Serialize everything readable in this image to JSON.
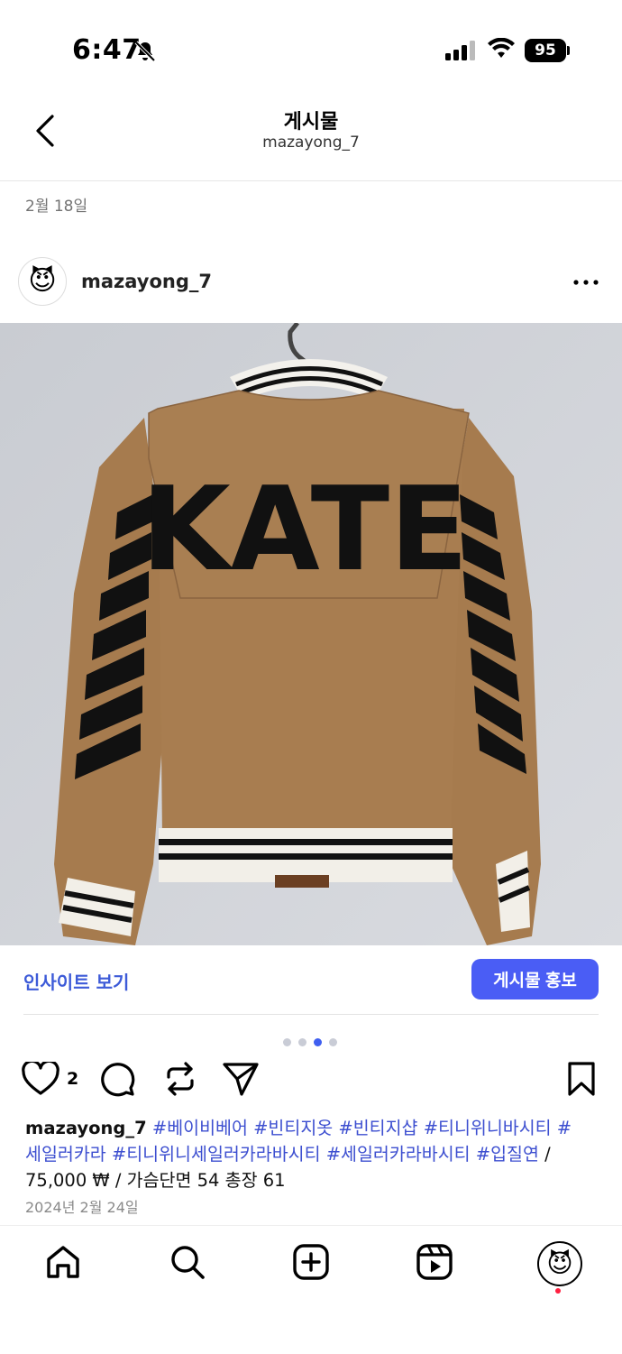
{
  "status": {
    "time": "6:47",
    "battery": "95"
  },
  "header": {
    "title": "게시물",
    "subtitle": "mazayong_7"
  },
  "post": {
    "date_top": "2월 18일",
    "username": "mazayong_7",
    "image": {
      "jacket_text": "KATE"
    },
    "insight_label": "인사이트 보기",
    "promote_label": "게시물 홍보",
    "carousel": {
      "count": 4,
      "active_index": 2
    },
    "like_count": "2",
    "caption": {
      "username": "mazayong_7",
      "hashtags_line1": "#베이비베어 #빈티지옷 #빈티지샵 #티니위니바시티 #",
      "hashtags_line2": "세일러카라  #티니위니세일러카라바시티  #세일러카라바시티 #입질연",
      "slash": " /",
      "line3": "75,000 ₩ / 가슴단면 54 총장 61"
    },
    "date_bottom": "2024년 2월 24일"
  },
  "colors": {
    "accent": "#4a5df5",
    "link": "#3d4fd0",
    "jacket": "#a67b4e"
  },
  "icons": {
    "avatar": "smiling-devil-emoji",
    "tabs": [
      "home-icon",
      "search-icon",
      "create-icon",
      "reels-icon",
      "profile-avatar"
    ]
  }
}
